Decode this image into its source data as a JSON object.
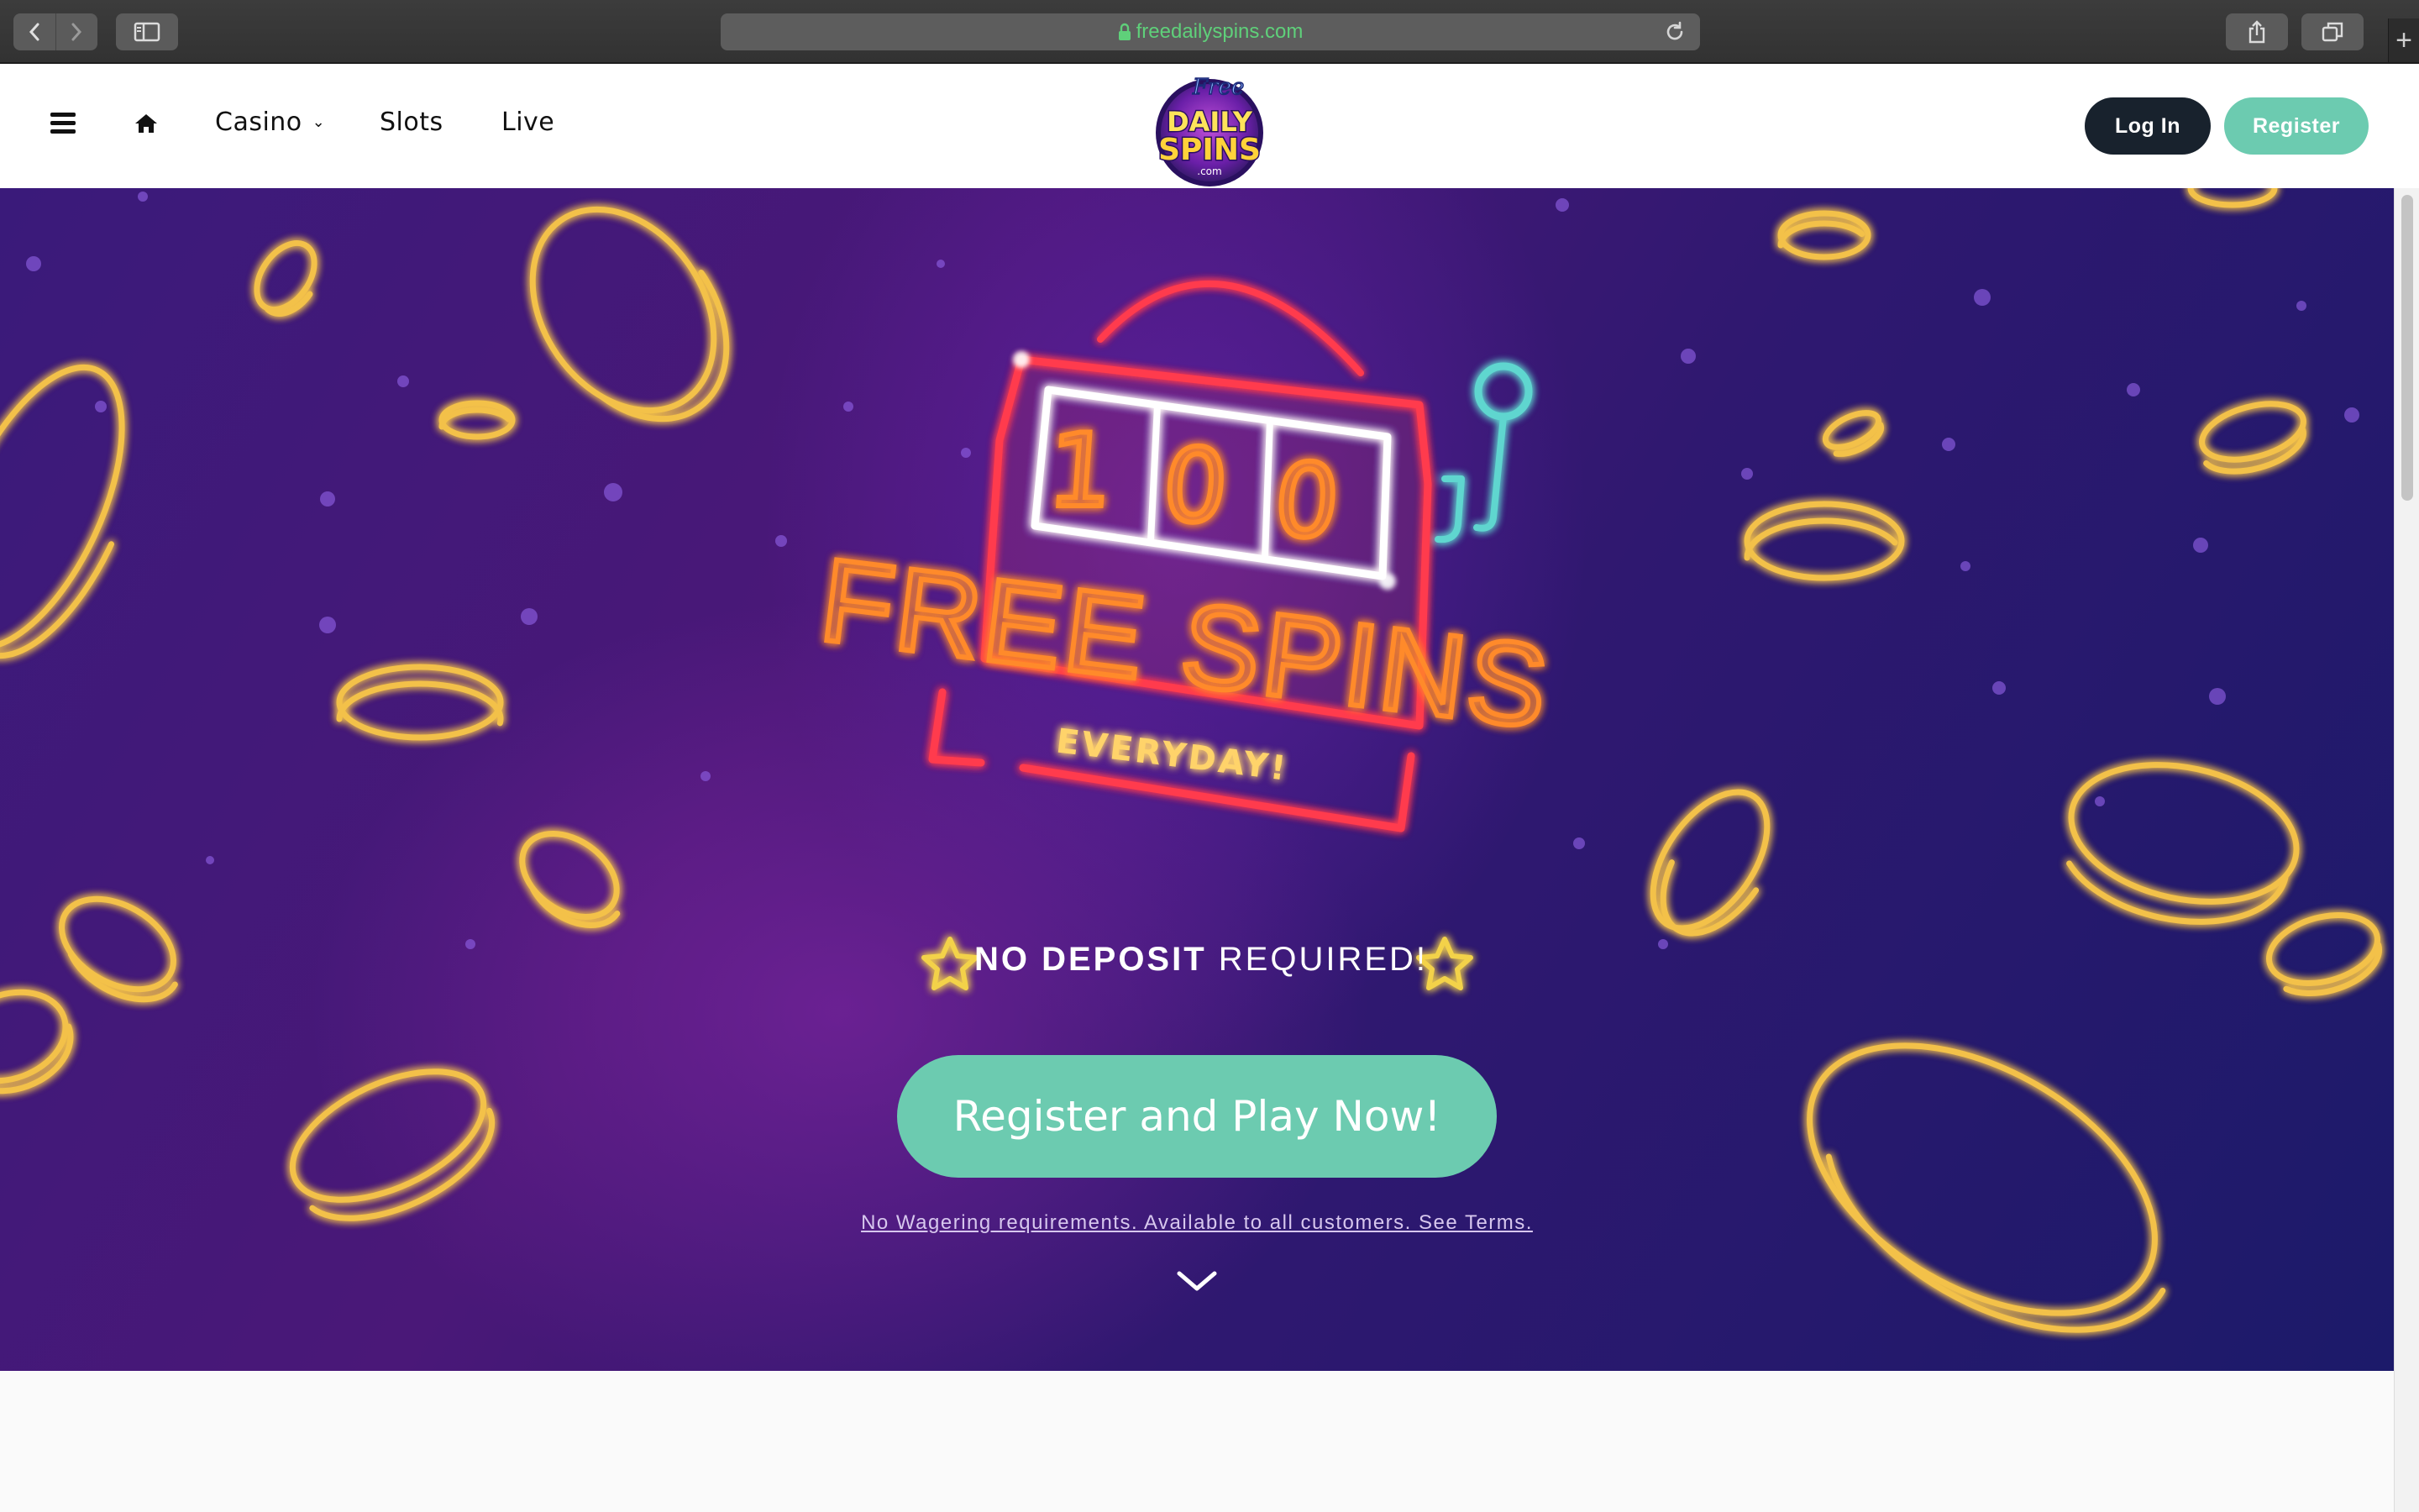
{
  "browser": {
    "url": "freedailyspins.com",
    "new_tab_label": "+"
  },
  "nav": {
    "items": [
      {
        "label": "Casino"
      },
      {
        "label": "Slots"
      },
      {
        "label": "Live"
      }
    ],
    "logo": {
      "line1": "Free",
      "line2": "DAILY",
      "line3": "SPINS",
      "line4": ".com"
    },
    "login_label": "Log In",
    "register_label": "Register"
  },
  "hero": {
    "reel_digits": [
      "1",
      "0",
      "0"
    ],
    "headline": "FREE SPINS",
    "subheadline": "EVERYDAY!",
    "no_deposit_bold": "NO DEPOSIT",
    "no_deposit_rest": "REQUIRED!",
    "cta_label": "Register and Play Now!",
    "terms_text": "No Wagering requirements. Available to all customers. See Terms."
  },
  "colors": {
    "accent": "#6ccbb0",
    "dark_button": "#18222d",
    "neon_red": "#ff3b4e",
    "neon_orange": "#ff8a2a",
    "neon_gold": "#f3c14a",
    "neon_teal": "#5ed6cf"
  }
}
